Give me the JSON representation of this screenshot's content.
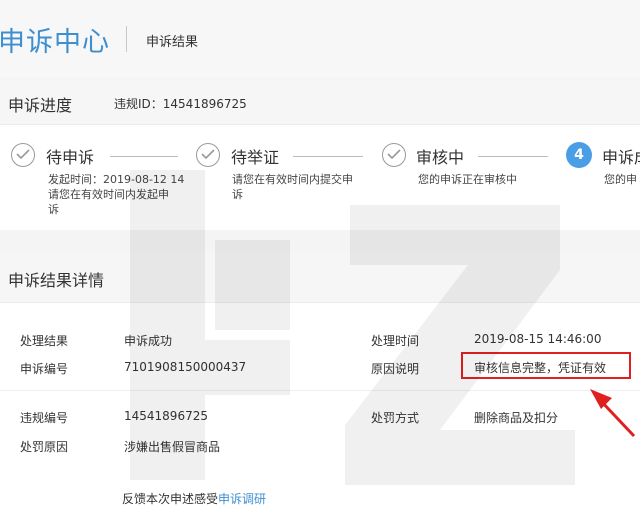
{
  "header": {
    "app_title": "申诉中心",
    "subtitle": "申诉结果"
  },
  "progress": {
    "title": "申诉进度",
    "violation_id": "违规ID：14541896725",
    "steps": [
      {
        "label": "待申诉",
        "status": "done",
        "desc_lines": [
          "发起时间：2019-08-12 14",
          "请您在有效时间内发起申",
          "诉"
        ]
      },
      {
        "label": "待举证",
        "status": "done",
        "desc_lines": [
          "请您在有效时间内提交申",
          "诉"
        ]
      },
      {
        "label": "审核中",
        "status": "done",
        "desc_lines": [
          "您的申诉正在审核中"
        ]
      },
      {
        "label": "申诉成",
        "status": "current",
        "number": "4",
        "desc_lines": [
          "您的申"
        ]
      }
    ]
  },
  "details": {
    "title": "申诉结果详情",
    "rows": [
      {
        "label": "处理结果",
        "value": "申诉成功"
      },
      {
        "label": "申诉编号",
        "value": "7101908150000437"
      },
      {
        "label": "处理时间",
        "value": "2019-08-15 14:46:00"
      },
      {
        "label": "原因说明",
        "value": "审核信息完整，凭证有效"
      },
      {
        "label": "违规编号",
        "value": "14541896725"
      },
      {
        "label": "处罚原因",
        "value": "涉嫌出售假冒商品"
      },
      {
        "label": "处罚方式",
        "value": "删除商品及扣分"
      }
    ],
    "feedback_text": "反馈本次申述感受",
    "feedback_link": "申诉调研"
  },
  "colors": {
    "accent": "#3d8fd0",
    "highlight": "#e02020",
    "step_active": "#4a9ee6"
  }
}
